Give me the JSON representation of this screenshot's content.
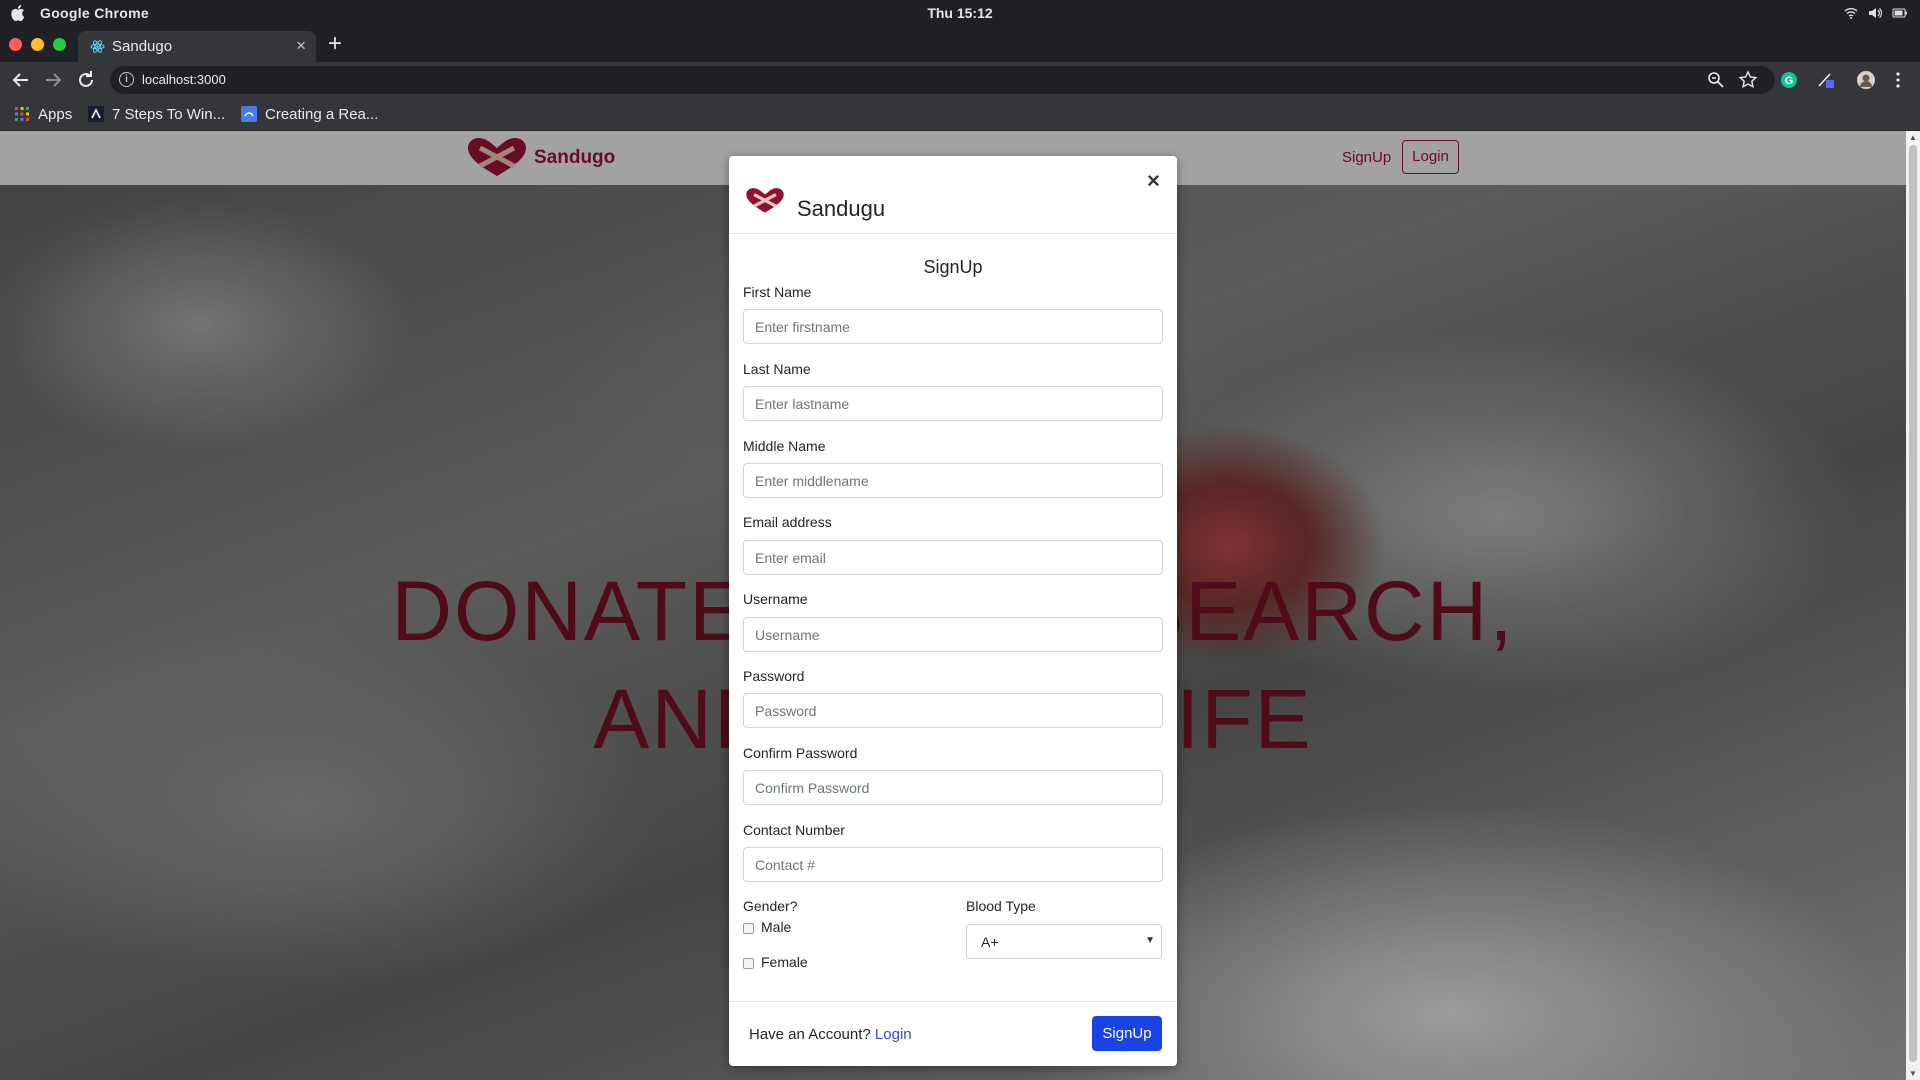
{
  "os": {
    "app_name": "Google Chrome",
    "clock": "Thu 15:12"
  },
  "browser": {
    "tab_title": "Sandugo",
    "tab_close": "×",
    "new_tab": "+",
    "url": "localhost:3000",
    "bookmarks": [
      "Apps",
      "7 Steps To Win...",
      "Creating a Rea..."
    ]
  },
  "page": {
    "brand": "Sandugo",
    "nav_signup": "SignUp",
    "nav_login": "Login",
    "hero_line1": "DONATE BLOOD, SEARCH,",
    "hero_line2": "AND SAVE A LIFE"
  },
  "modal": {
    "title": "Sandugu",
    "close": "×",
    "heading": "SignUp",
    "fields": [
      {
        "label": "First Name",
        "placeholder": "Enter firstname"
      },
      {
        "label": "Last Name",
        "placeholder": "Enter lastname"
      },
      {
        "label": "Middle Name",
        "placeholder": "Enter middlename"
      },
      {
        "label": "Email address",
        "placeholder": "Enter email"
      },
      {
        "label": "Username",
        "placeholder": "Username"
      },
      {
        "label": "Password",
        "placeholder": "Password"
      },
      {
        "label": "Confirm Password",
        "placeholder": "Confirm Password"
      },
      {
        "label": "Contact Number",
        "placeholder": "Contact #"
      }
    ],
    "gender_label": "Gender?",
    "gender_options": [
      "Male",
      "Female"
    ],
    "blood_type_label": "Blood Type",
    "blood_type_value": "A+",
    "footer_text": "Have an Account? ",
    "footer_login": "Login",
    "footer_signup": "SignUp"
  },
  "colors": {
    "brand": "#8c1230",
    "primary": "#1a43e6",
    "link": "#2950d6"
  }
}
